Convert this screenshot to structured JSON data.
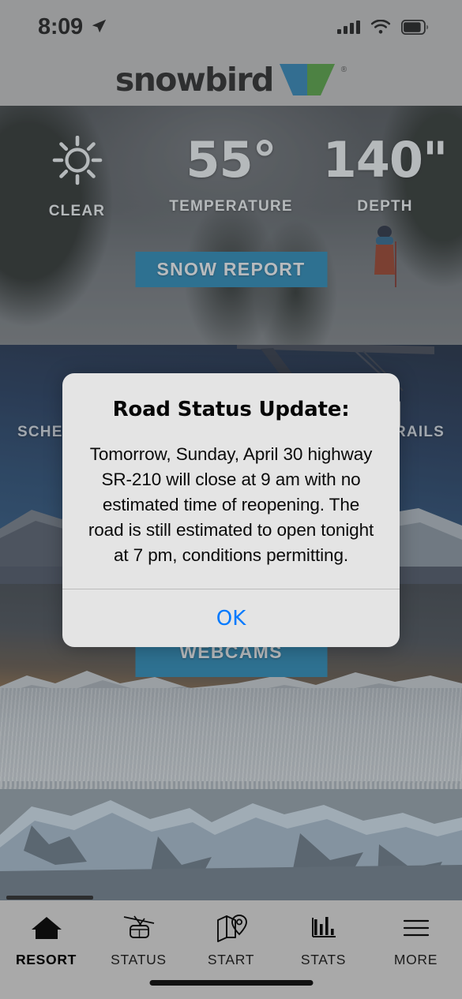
{
  "status_bar": {
    "time": "8:09",
    "location_icon": "location-arrow-icon",
    "signal_icon": "cellular-signal-icon",
    "signal_bars": 4,
    "wifi_icon": "wifi-icon",
    "battery_icon": "battery-icon",
    "battery_level_pct": 78
  },
  "header": {
    "brand": "snowbird",
    "logo_icon": "snowbird-bird-logo",
    "registered_mark": "®",
    "logo_colors": {
      "blue": "#1a6d9e",
      "green": "#3f8a2e"
    }
  },
  "weather": {
    "condition_icon": "sun-clear-icon",
    "condition_label": "CLEAR",
    "temperature_value": "55°",
    "temperature_label": "TEMPERATURE",
    "depth_value": "140\"",
    "depth_label": "DEPTH",
    "snow_report_button": "SNOW REPORT"
  },
  "panels": {
    "tram": {
      "left_label": "SCHED",
      "right_label": "TRAILS"
    },
    "webcams": {
      "button": "WEBCAMS"
    }
  },
  "modal": {
    "title": "Road Status Update:",
    "message": "Tomorrow, Sunday, April 30 highway SR-210 will close at 9 am with no estimated time of reopening. The road is still estimated to open tonight at 7 pm, conditions permitting.",
    "ok_label": "OK",
    "ok_color": "#007aff"
  },
  "tabs": [
    {
      "label": "RESORT",
      "icon": "home-icon",
      "active": true
    },
    {
      "label": "STATUS",
      "icon": "tram-icon",
      "active": false
    },
    {
      "label": "START",
      "icon": "map-pin-icon",
      "active": false
    },
    {
      "label": "STATS",
      "icon": "bar-chart-icon",
      "active": false
    },
    {
      "label": "MORE",
      "icon": "hamburger-menu-icon",
      "active": false
    }
  ],
  "colors": {
    "accent_blue": "#14719e",
    "chrome_gray": "#a9a9a9",
    "modal_bg": "#e4e4e4"
  }
}
